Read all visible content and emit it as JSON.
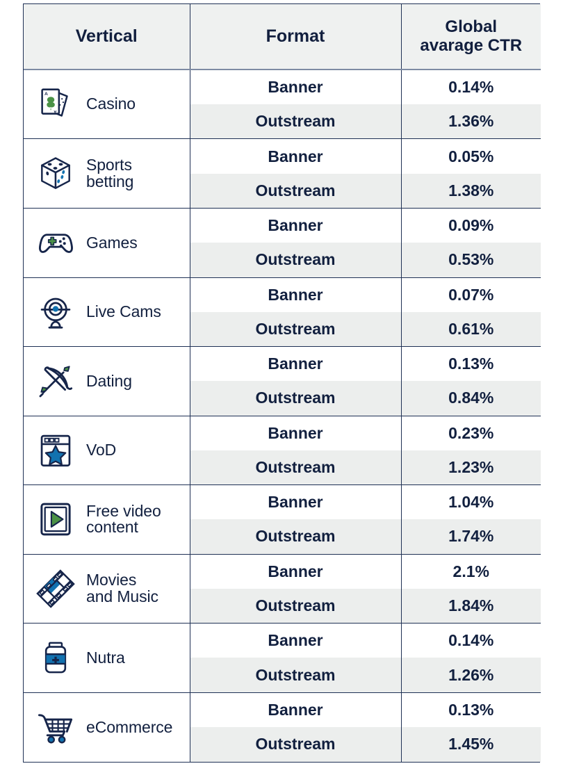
{
  "table": {
    "headers": {
      "vertical": "Vertical",
      "format": "Format",
      "ctr_line1": "Global",
      "ctr_line2": "avarage CTR"
    },
    "colors": {
      "border": "#1e3054",
      "header_bg": "#eff1f0",
      "header_rule": "#7e8ba3",
      "alt_row_bg": "#eceeed",
      "text": "#12203f",
      "accent_green": "#4b9246",
      "accent_blue": "#1272b0",
      "accent_navy": "#16254a"
    },
    "rows": [
      {
        "vertical": "Casino",
        "vertical_lines": [
          "Casino"
        ],
        "icon": "playing-cards-icon",
        "formats": [
          {
            "format": "Banner",
            "ctr": "0.14%"
          },
          {
            "format": "Outstream",
            "ctr": "1.36%"
          }
        ]
      },
      {
        "vertical": "Sports betting",
        "vertical_lines": [
          "Sports",
          "betting"
        ],
        "icon": "dice-icon",
        "formats": [
          {
            "format": "Banner",
            "ctr": "0.05%"
          },
          {
            "format": "Outstream",
            "ctr": "1.38%"
          }
        ]
      },
      {
        "vertical": "Games",
        "vertical_lines": [
          "Games"
        ],
        "icon": "gamepad-icon",
        "formats": [
          {
            "format": "Banner",
            "ctr": "0.09%"
          },
          {
            "format": "Outstream",
            "ctr": "0.53%"
          }
        ]
      },
      {
        "vertical": "Live Cams",
        "vertical_lines": [
          "Live Cams"
        ],
        "icon": "webcam-icon",
        "formats": [
          {
            "format": "Banner",
            "ctr": "0.07%"
          },
          {
            "format": "Outstream",
            "ctr": "0.61%"
          }
        ]
      },
      {
        "vertical": "Dating",
        "vertical_lines": [
          "Dating"
        ],
        "icon": "bow-arrow-icon",
        "formats": [
          {
            "format": "Banner",
            "ctr": "0.13%"
          },
          {
            "format": "Outstream",
            "ctr": "0.84%"
          }
        ]
      },
      {
        "vertical": "VoD",
        "vertical_lines": [
          "VoD"
        ],
        "icon": "browser-star-icon",
        "formats": [
          {
            "format": "Banner",
            "ctr": "0.23%"
          },
          {
            "format": "Outstream",
            "ctr": "1.23%"
          }
        ]
      },
      {
        "vertical": "Free video content",
        "vertical_lines": [
          "Free video",
          "content"
        ],
        "icon": "video-play-icon",
        "formats": [
          {
            "format": "Banner",
            "ctr": "1.04%"
          },
          {
            "format": "Outstream",
            "ctr": "1.74%"
          }
        ]
      },
      {
        "vertical": "Movies and Music",
        "vertical_lines": [
          "Movies",
          "and Music"
        ],
        "icon": "film-strip-icon",
        "formats": [
          {
            "format": "Banner",
            "ctr": "2.1%"
          },
          {
            "format": "Outstream",
            "ctr": "1.84%"
          }
        ]
      },
      {
        "vertical": "Nutra",
        "vertical_lines": [
          "Nutra"
        ],
        "icon": "supplement-bottle-icon",
        "formats": [
          {
            "format": "Banner",
            "ctr": "0.14%"
          },
          {
            "format": "Outstream",
            "ctr": "1.26%"
          }
        ]
      },
      {
        "vertical": "eCommerce",
        "vertical_lines": [
          "eCommerce"
        ],
        "icon": "shopping-cart-icon",
        "formats": [
          {
            "format": "Banner",
            "ctr": "0.13%"
          },
          {
            "format": "Outstream",
            "ctr": "1.45%"
          }
        ]
      }
    ]
  },
  "chart_data": {
    "type": "table",
    "title": "Global avarage CTR",
    "columns": [
      "Vertical",
      "Format",
      "Global avarage CTR"
    ],
    "rows": [
      [
        "Casino",
        "Banner",
        0.14
      ],
      [
        "Casino",
        "Outstream",
        1.36
      ],
      [
        "Sports betting",
        "Banner",
        0.05
      ],
      [
        "Sports betting",
        "Outstream",
        1.38
      ],
      [
        "Games",
        "Banner",
        0.09
      ],
      [
        "Games",
        "Outstream",
        0.53
      ],
      [
        "Live Cams",
        "Banner",
        0.07
      ],
      [
        "Live Cams",
        "Outstream",
        0.61
      ],
      [
        "Dating",
        "Banner",
        0.13
      ],
      [
        "Dating",
        "Outstream",
        0.84
      ],
      [
        "VoD",
        "Banner",
        0.23
      ],
      [
        "VoD",
        "Outstream",
        1.23
      ],
      [
        "Free video content",
        "Banner",
        1.04
      ],
      [
        "Free video content",
        "Outstream",
        1.74
      ],
      [
        "Movies and Music",
        "Banner",
        2.1
      ],
      [
        "Movies and Music",
        "Outstream",
        1.84
      ],
      [
        "Nutra",
        "Banner",
        0.14
      ],
      [
        "Nutra",
        "Outstream",
        1.26
      ],
      [
        "eCommerce",
        "Banner",
        0.13
      ],
      [
        "eCommerce",
        "Outstream",
        1.45
      ]
    ],
    "unit": "%"
  }
}
